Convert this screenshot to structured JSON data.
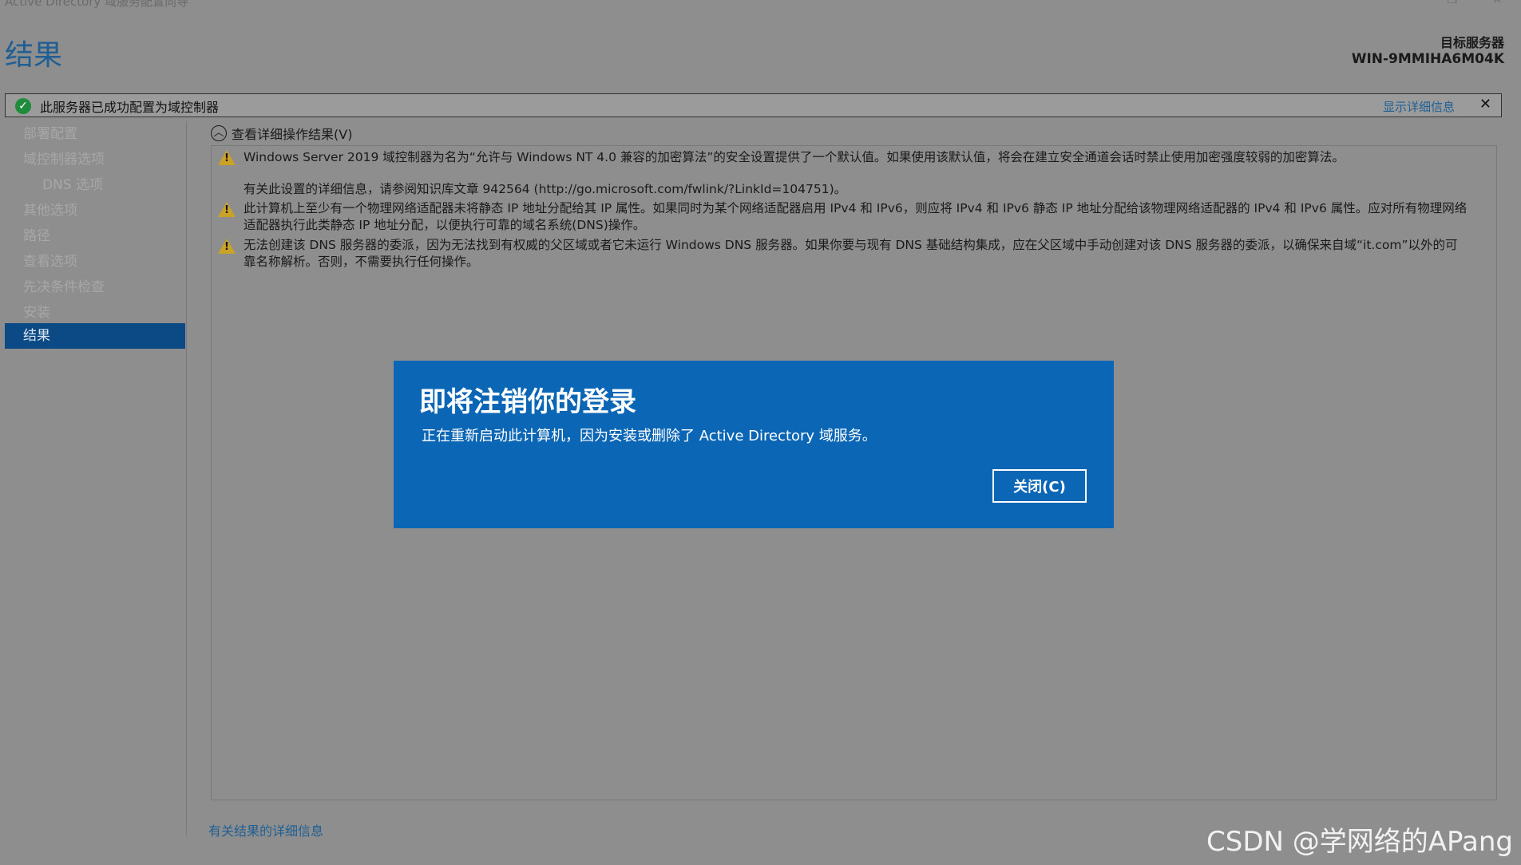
{
  "window": {
    "title": "Active Directory 域服务配置向导",
    "restore_glyph": "❐",
    "close_glyph": "✕"
  },
  "header": {
    "page_title": "结果",
    "target_label": "目标服务器",
    "target_host": "WIN-9MMIHA6M04K"
  },
  "notice": {
    "icon": "check-circle-icon",
    "message": "此服务器已成功配置为域控制器",
    "details_link": "显示详细信息",
    "close_glyph": "✕"
  },
  "sidebar": {
    "items": [
      {
        "label": "部署配置",
        "sub": false,
        "active": false
      },
      {
        "label": "域控制器选项",
        "sub": false,
        "active": false
      },
      {
        "label": "DNS 选项",
        "sub": true,
        "active": false
      },
      {
        "label": "其他选项",
        "sub": false,
        "active": false
      },
      {
        "label": "路径",
        "sub": false,
        "active": false
      },
      {
        "label": "查看选项",
        "sub": false,
        "active": false
      },
      {
        "label": "先决条件检查",
        "sub": false,
        "active": false
      },
      {
        "label": "安装",
        "sub": false,
        "active": false
      },
      {
        "label": "结果",
        "sub": false,
        "active": true
      }
    ]
  },
  "results": {
    "expander_label": "查看详细操作结果(V)",
    "warnings": [
      {
        "line1": "Windows Server 2019 域控制器为名为“允许与 Windows NT 4.0 兼容的加密算法”的安全设置提供了一个默认值。如果使用该默认值，将会在建立安全通道会话时禁止使用加密强度较弱的加密算法。",
        "line2": "有关此设置的详细信息，请参阅知识库文章 942564 (http://go.microsoft.com/fwlink/?LinkId=104751)。"
      },
      {
        "line1": "此计算机上至少有一个物理网络适配器未将静态 IP 地址分配给其 IP 属性。如果同时为某个网络适配器启用 IPv4 和 IPv6，则应将 IPv4 和 IPv6 静态 IP 地址分配给该物理网络适配器的 IPv4 和 IPv6 属性。应对所有物理网络",
        "line2": "适配器执行此类静态 IP 地址分配，以便执行可靠的域名系统(DNS)操作。"
      },
      {
        "line1": "无法创建该 DNS 服务器的委派，因为无法找到有权威的父区域或者它未运行 Windows DNS 服务器。如果你要与现有 DNS 基础结构集成，应在父区域中手动创建对该 DNS 服务器的委派，以确保来自域“it.com”以外的可",
        "line2": "靠名称解析。否则，不需要执行任何操作。"
      }
    ],
    "more_link": "有关结果的详细信息"
  },
  "dialog": {
    "heading": "即将注销你的登录",
    "body": "正在重新启动此计算机，因为安装或删除了 Active Directory 域服务。",
    "close_button": "关闭(C)"
  },
  "watermark": "CSDN @学网络的APang"
}
